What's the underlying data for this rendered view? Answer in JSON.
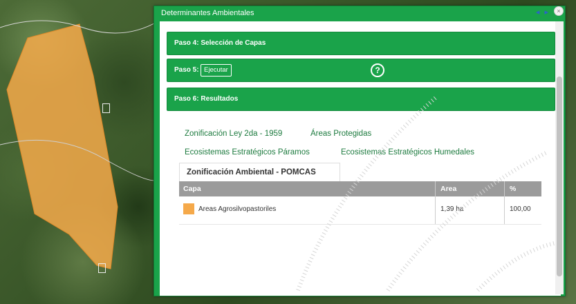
{
  "window": {
    "title": "Determinantes Ambientales",
    "controls": "◂ ▸",
    "close": "×"
  },
  "steps": [
    {
      "label": "Paso 4: Selección de Capas"
    },
    {
      "label": "Paso 5:",
      "button": "Ejecutar",
      "help": "?"
    },
    {
      "label": "Paso 6: Resultados"
    }
  ],
  "result_tabs": {
    "row1": [
      "Zonificación Ley 2da - 1959",
      "Áreas Protegidas"
    ],
    "row2": [
      "Ecosistemas Estratégicos Páramos",
      "Ecosistemas Estratégicos Humedales"
    ],
    "active": "Zonificación Ambiental - POMCAS"
  },
  "table": {
    "headers": [
      "Capa",
      "Area",
      "%"
    ],
    "rows": [
      {
        "swatch": "#f5a94a",
        "capa": "Areas Agrosilvopastoriles",
        "area": "1,39 ha",
        "pct": "100,00"
      }
    ]
  },
  "colors": {
    "accent": "#1aa34a",
    "polygon": "#f5a94a"
  }
}
